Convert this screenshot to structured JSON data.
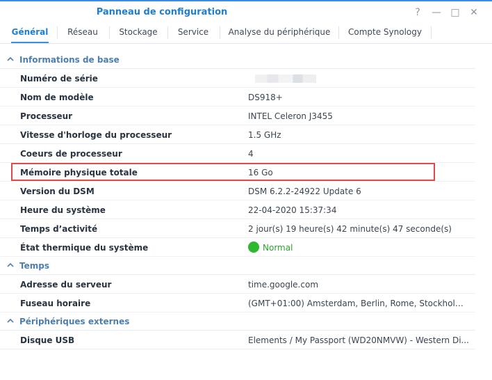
{
  "window": {
    "title": "Panneau de configuration",
    "controls": {
      "help": "?",
      "minimize": "—",
      "maximize": "□",
      "close": "✕"
    }
  },
  "tabs": [
    {
      "label": "Général",
      "active": true
    },
    {
      "label": "Réseau",
      "active": false
    },
    {
      "label": "Stockage",
      "active": false
    },
    {
      "label": "Service",
      "active": false
    },
    {
      "label": "Analyse du périphérique",
      "active": false
    },
    {
      "label": "Compte Synology",
      "active": false
    }
  ],
  "sections": {
    "basic": {
      "title": "Informations de base",
      "rows": [
        {
          "key": "Numéro de série",
          "value": ""
        },
        {
          "key": "Nom de modèle",
          "value": "DS918+"
        },
        {
          "key": "Processeur",
          "value": "INTEL Celeron J3455"
        },
        {
          "key": "Vitesse d'horloge du processeur",
          "value": "1.5 GHz"
        },
        {
          "key": "Coeurs de processeur",
          "value": "4"
        },
        {
          "key": "Mémoire physique totale",
          "value": "16 Go"
        },
        {
          "key": "Version du DSM",
          "value": "DSM 6.2.2-24922 Update 6"
        },
        {
          "key": "Heure du système",
          "value": "22-04-2020 15:37:34"
        },
        {
          "key": "Temps d’activité",
          "value": "2 jour(s) 19 heure(s) 42 minute(s) 47 seconde(s)"
        },
        {
          "key": "État thermique du système",
          "value": "Normal"
        }
      ]
    },
    "time": {
      "title": "Temps",
      "rows": [
        {
          "key": "Adresse du serveur",
          "value": "time.google.com"
        },
        {
          "key": "Fuseau horaire",
          "value": "(GMT+01:00) Amsterdam, Berlin, Rome, Stockholm..."
        }
      ]
    },
    "external": {
      "title": "Périphériques externes",
      "rows": [
        {
          "key": "Disque USB",
          "value": "Elements / My Passport (WD20NMVW) - Western Di..."
        }
      ]
    }
  },
  "colors": {
    "accent": "#1e7ecf",
    "section_title": "#4d7fae",
    "status_ok": "#2eb82e",
    "highlight": "#e04a4a"
  },
  "icons": {
    "collapse": "chevron-up-icon",
    "status": "status-ok-dot-icon"
  }
}
